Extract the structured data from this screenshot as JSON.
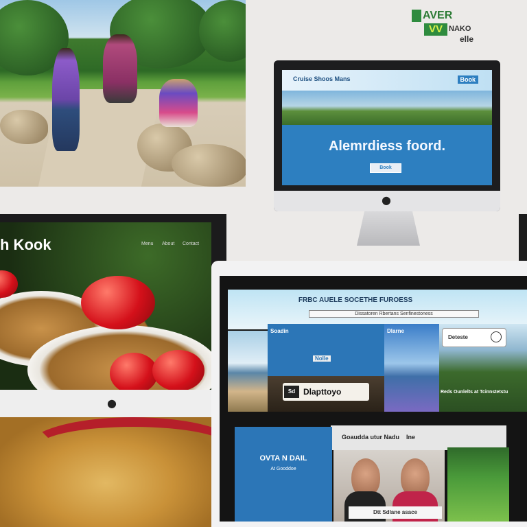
{
  "logo": {
    "line1": "AVER",
    "badge": "VV",
    "line2": "NAKO",
    "line3": "elle"
  },
  "imac_top": {
    "nav_text": "Cruise Shoos Mans",
    "nav_button": "Book",
    "headline": "Alemrdiess foord.",
    "cta": "Book"
  },
  "food_screen": {
    "title": "h Kook",
    "nav_items": [
      "Menu",
      "About",
      "Contact"
    ]
  },
  "right_screen": {
    "heading": "FRBC AUELE SOCETHE FUROESS",
    "subtitle": "Dissatoren Rbertans Senfinestoness",
    "panel_a_label": "Soadin",
    "panel_a_badge": "Nolle",
    "panel_b_label": "Dlarne",
    "overlay_text": "Dlapttoyo",
    "overlay_icon": "Sd",
    "card_text": "Deteste",
    "panel_c_text": "Reds Ounlelts at Tcinnstetstu",
    "mid_bar_text": "Goaudda utur Nadu",
    "mid_bar_tag": "Ine",
    "contact_title": "OVTA N DAIL",
    "contact_sub": "At Gooddoe",
    "video_caption": "Dtt Sdlane asace"
  },
  "colors": {
    "accent_blue": "#2c76b7",
    "brand_green": "#2e8b3e",
    "tomato": "#d4101a"
  }
}
